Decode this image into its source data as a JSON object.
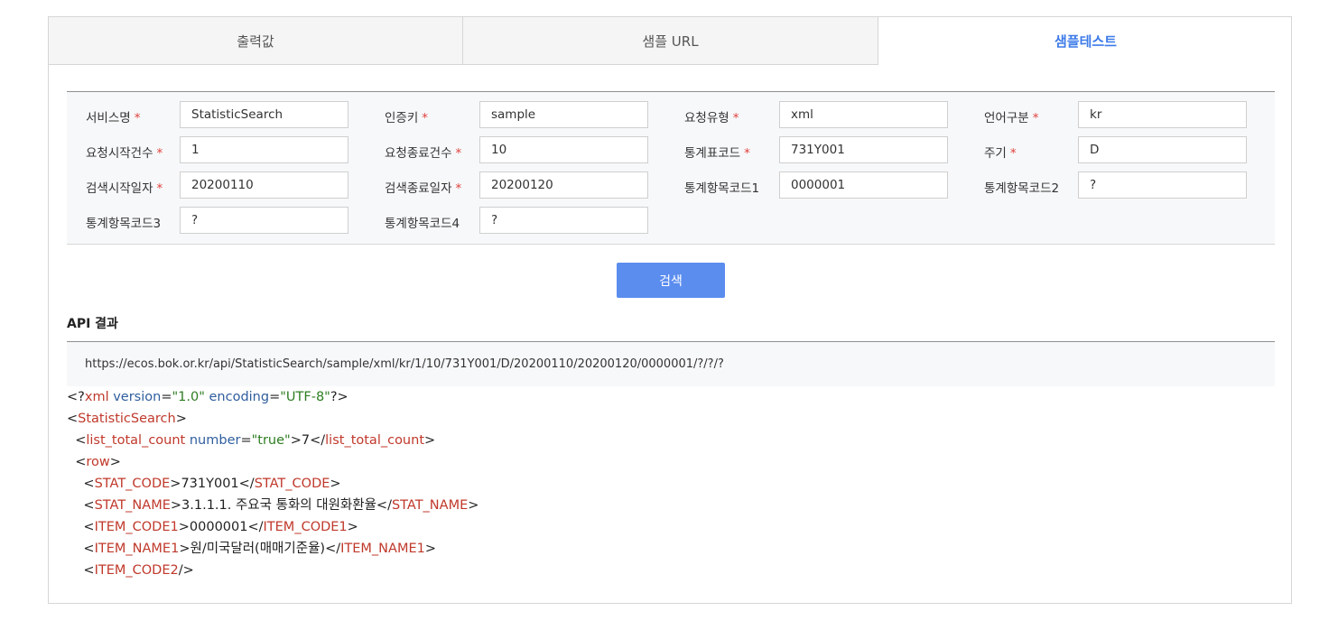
{
  "tabs": [
    {
      "label": "출력값",
      "active": false
    },
    {
      "label": "샘플 URL",
      "active": false
    },
    {
      "label": "샘플테스트",
      "active": true
    }
  ],
  "colors": {
    "accent": "#3d7be8",
    "button": "#5b8def",
    "required": "#e0403c",
    "tag": "#c0392b",
    "attr": "#2f5e9e",
    "value": "#2e7d22"
  },
  "form": {
    "required_mark": "*",
    "fields": [
      {
        "label": "서비스명",
        "required": true,
        "value": "StatisticSearch"
      },
      {
        "label": "인증키",
        "required": true,
        "value": "sample"
      },
      {
        "label": "요청유형",
        "required": true,
        "value": "xml"
      },
      {
        "label": "언어구분",
        "required": true,
        "value": "kr"
      },
      {
        "label": "요청시작건수",
        "required": true,
        "value": "1"
      },
      {
        "label": "요청종료건수",
        "required": true,
        "value": "10"
      },
      {
        "label": "통계표코드",
        "required": true,
        "value": "731Y001"
      },
      {
        "label": "주기",
        "required": true,
        "value": "D"
      },
      {
        "label": "검색시작일자",
        "required": true,
        "value": "20200110"
      },
      {
        "label": "검색종료일자",
        "required": true,
        "value": "20200120"
      },
      {
        "label": "통계항목코드1",
        "required": false,
        "value": "0000001"
      },
      {
        "label": "통계항목코드2",
        "required": false,
        "value": "?"
      },
      {
        "label": "통계항목코드3",
        "required": false,
        "value": "?"
      },
      {
        "label": "통계항목코드4",
        "required": false,
        "value": "?"
      }
    ]
  },
  "search_button": "검색",
  "api_result": {
    "title": "API 결과",
    "url": "https://ecos.bok.or.kr/api/StatisticSearch/sample/xml/kr/1/10/731Y001/D/20200110/20200120/0000001/?/?/?"
  },
  "xml_lines": [
    [
      {
        "t": "p",
        "v": "<?"
      },
      {
        "t": "tag",
        "v": "xml"
      },
      {
        "t": "p",
        "v": " "
      },
      {
        "t": "attr",
        "v": "version"
      },
      {
        "t": "p",
        "v": "="
      },
      {
        "t": "val",
        "v": "\"1.0\""
      },
      {
        "t": "p",
        "v": " "
      },
      {
        "t": "attr",
        "v": "encoding"
      },
      {
        "t": "p",
        "v": "="
      },
      {
        "t": "val",
        "v": "\"UTF-8\""
      },
      {
        "t": "p",
        "v": "?>"
      }
    ],
    [
      {
        "t": "p",
        "v": "<"
      },
      {
        "t": "tag",
        "v": "StatisticSearch"
      },
      {
        "t": "p",
        "v": ">"
      }
    ],
    [
      {
        "t": "p",
        "v": "  <"
      },
      {
        "t": "tag",
        "v": "list_total_count"
      },
      {
        "t": "p",
        "v": " "
      },
      {
        "t": "attr",
        "v": "number"
      },
      {
        "t": "p",
        "v": "="
      },
      {
        "t": "val",
        "v": "\"true\""
      },
      {
        "t": "p",
        "v": ">7</"
      },
      {
        "t": "tag",
        "v": "list_total_count"
      },
      {
        "t": "p",
        "v": ">"
      }
    ],
    [
      {
        "t": "p",
        "v": "  <"
      },
      {
        "t": "tag",
        "v": "row"
      },
      {
        "t": "p",
        "v": ">"
      }
    ],
    [
      {
        "t": "p",
        "v": "    <"
      },
      {
        "t": "tag",
        "v": "STAT_CODE"
      },
      {
        "t": "p",
        "v": ">731Y001</"
      },
      {
        "t": "tag",
        "v": "STAT_CODE"
      },
      {
        "t": "p",
        "v": ">"
      }
    ],
    [
      {
        "t": "p",
        "v": "    <"
      },
      {
        "t": "tag",
        "v": "STAT_NAME"
      },
      {
        "t": "p",
        "v": ">3.1.1.1. 주요국 통화의 대원화환율</"
      },
      {
        "t": "tag",
        "v": "STAT_NAME"
      },
      {
        "t": "p",
        "v": ">"
      }
    ],
    [
      {
        "t": "p",
        "v": "    <"
      },
      {
        "t": "tag",
        "v": "ITEM_CODE1"
      },
      {
        "t": "p",
        "v": ">0000001</"
      },
      {
        "t": "tag",
        "v": "ITEM_CODE1"
      },
      {
        "t": "p",
        "v": ">"
      }
    ],
    [
      {
        "t": "p",
        "v": "    <"
      },
      {
        "t": "tag",
        "v": "ITEM_NAME1"
      },
      {
        "t": "p",
        "v": ">원/미국달러(매매기준율)</"
      },
      {
        "t": "tag",
        "v": "ITEM_NAME1"
      },
      {
        "t": "p",
        "v": ">"
      }
    ],
    [
      {
        "t": "p",
        "v": "    <"
      },
      {
        "t": "tag",
        "v": "ITEM_CODE2"
      },
      {
        "t": "p",
        "v": "/>"
      }
    ]
  ]
}
